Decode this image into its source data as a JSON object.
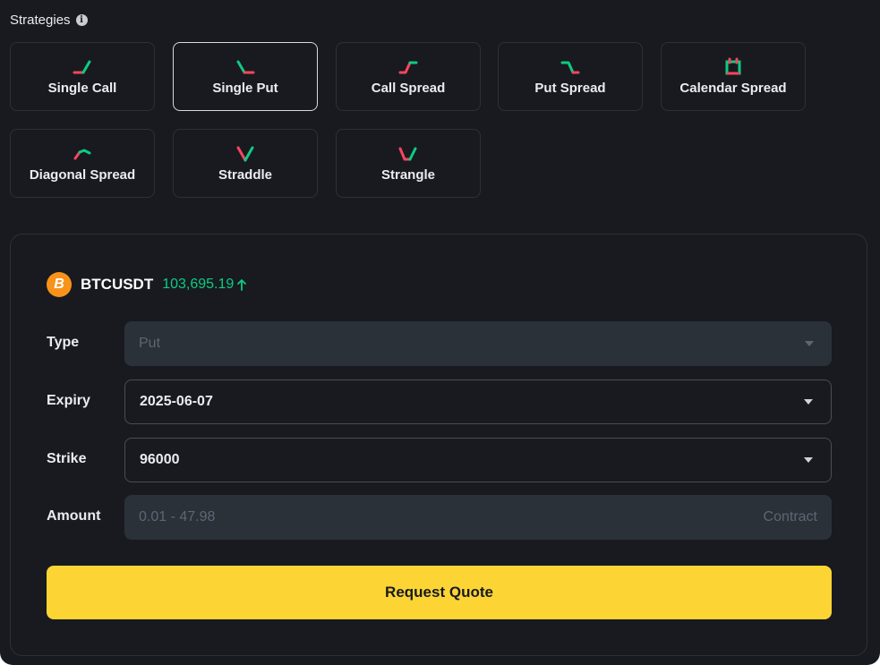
{
  "header": {
    "title": "Strategies",
    "info_icon": "info-icon"
  },
  "strategies": [
    {
      "label": "Single Call",
      "icon": "single-call-icon",
      "active": false
    },
    {
      "label": "Single Put",
      "icon": "single-put-icon",
      "active": true
    },
    {
      "label": "Call Spread",
      "icon": "call-spread-icon",
      "active": false
    },
    {
      "label": "Put Spread",
      "icon": "put-spread-icon",
      "active": false
    },
    {
      "label": "Calendar Spread",
      "icon": "calendar-spread-icon",
      "active": false
    },
    {
      "label": "Diagonal Spread",
      "icon": "diagonal-spread-icon",
      "active": false
    },
    {
      "label": "Straddle",
      "icon": "straddle-icon",
      "active": false
    },
    {
      "label": "Strangle",
      "icon": "strangle-icon",
      "active": false
    }
  ],
  "ticker": {
    "logo_letter": "B",
    "symbol": "BTCUSDT",
    "price": "103,695.19",
    "direction": "up"
  },
  "form": {
    "type": {
      "label": "Type",
      "value": "Put",
      "disabled": true
    },
    "expiry": {
      "label": "Expiry",
      "value": "2025-06-07"
    },
    "strike": {
      "label": "Strike",
      "value": "96000"
    },
    "amount": {
      "label": "Amount",
      "placeholder": "0.01 - 47.98",
      "unit": "Contract"
    }
  },
  "actions": {
    "request_quote": "Request Quote"
  },
  "colors": {
    "background": "#181a20",
    "border": "#2b3139",
    "up_green": "#0ecb81",
    "down_red": "#f6465d",
    "accent_yellow": "#fcd535",
    "btc_orange": "#f7931a"
  }
}
